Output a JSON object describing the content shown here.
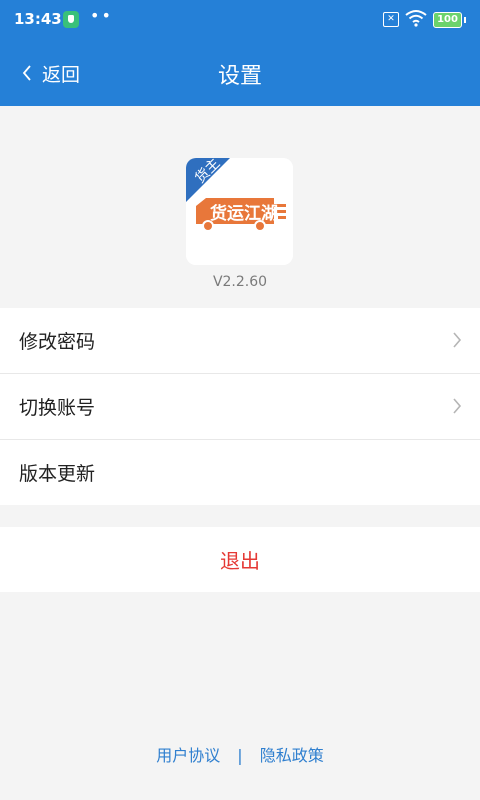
{
  "status_bar": {
    "time": "13:43",
    "battery": "100",
    "sim_label": "✕"
  },
  "header": {
    "back_label": "返回",
    "title": "设置"
  },
  "app": {
    "logo_text": "货运江湖",
    "badge_text": "货主",
    "version": "V2.2.60",
    "brand_color": "#e8773a"
  },
  "menu": {
    "items": [
      {
        "label": "修改密码",
        "has_arrow": true
      },
      {
        "label": "切换账号",
        "has_arrow": true
      },
      {
        "label": "版本更新",
        "has_arrow": false
      }
    ]
  },
  "logout": {
    "label": "退出",
    "color": "#e53935"
  },
  "footer": {
    "user_agreement": "用户协议",
    "separator": "|",
    "privacy_policy": "隐私政策"
  },
  "colors": {
    "header_bg": "#2580d7",
    "page_bg": "#f4f4f4",
    "link": "#2f7fcf"
  }
}
